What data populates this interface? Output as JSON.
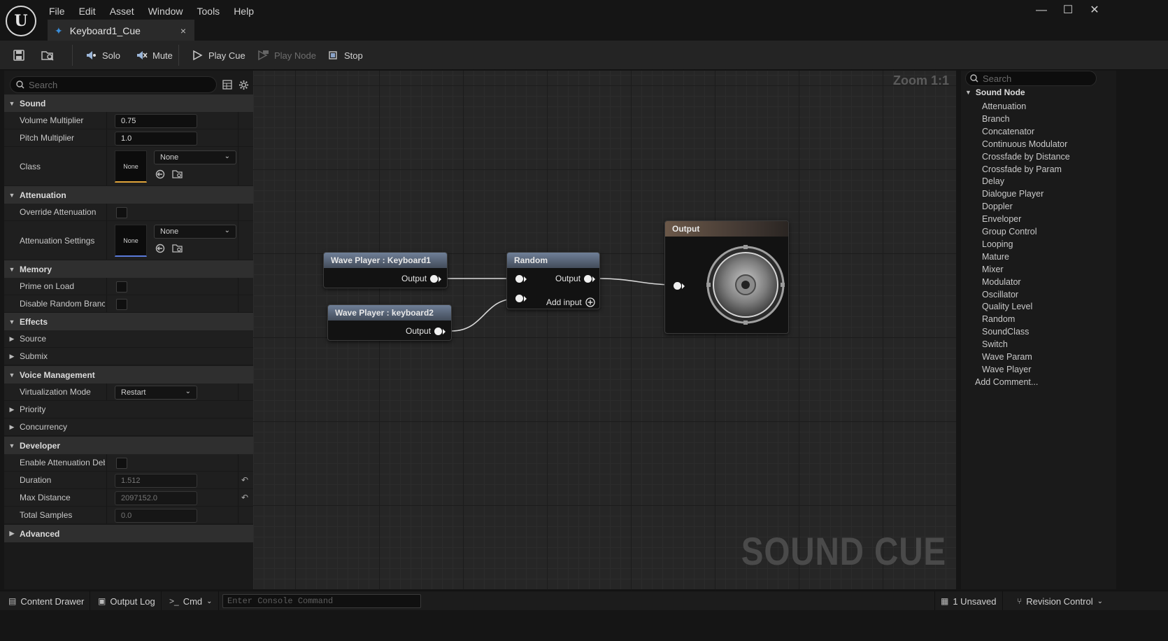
{
  "window": {
    "logo_text": "U",
    "menu": [
      "File",
      "Edit",
      "Asset",
      "Window",
      "Tools",
      "Help"
    ],
    "tab_label": "Keyboard1_Cue",
    "minimize": "—",
    "maximize": "☐",
    "close": "✕"
  },
  "toolbar": {
    "solo": "Solo",
    "mute": "Mute",
    "play_cue": "Play Cue",
    "play_node": "Play Node",
    "stop": "Stop"
  },
  "details": {
    "search_placeholder": "Search",
    "categories": {
      "sound": "Sound",
      "attenuation": "Attenuation",
      "memory": "Memory",
      "effects": "Effects",
      "voice_management": "Voice Management",
      "developer": "Developer",
      "advanced": "Advanced"
    },
    "volume_multiplier": {
      "label": "Volume Multiplier",
      "value": "0.75"
    },
    "pitch_multiplier": {
      "label": "Pitch Multiplier",
      "value": "1.0"
    },
    "class": {
      "label": "Class",
      "thumb": "None",
      "combo": "None"
    },
    "override_attenuation": {
      "label": "Override Attenuation",
      "checked": false
    },
    "attenuation_settings": {
      "label": "Attenuation Settings",
      "thumb": "None",
      "combo": "None"
    },
    "prime_on_load": {
      "label": "Prime on Load",
      "checked": false
    },
    "disable_random_branch": {
      "label": "Disable Random Branc...",
      "checked": false
    },
    "source": "Source",
    "submix": "Submix",
    "virtualization_mode": {
      "label": "Virtualization Mode",
      "value": "Restart"
    },
    "priority": "Priority",
    "concurrency": "Concurrency",
    "enable_attenuation_debug": {
      "label": "Enable Attenuation Deb...",
      "checked": false
    },
    "duration": {
      "label": "Duration",
      "value": "1.512"
    },
    "max_distance": {
      "label": "Max Distance",
      "value": "2097152.0"
    },
    "total_samples": {
      "label": "Total Samples",
      "value": "0.0"
    }
  },
  "graph": {
    "zoom": "Zoom 1:1",
    "watermark": "SOUND CUE",
    "nodes": {
      "wave1": {
        "title": "Wave Player : Keyboard1",
        "pin": "Output"
      },
      "wave2": {
        "title": "Wave Player : keyboard2",
        "pin": "Output"
      },
      "random": {
        "title": "Random",
        "output": "Output",
        "add_input": "Add input"
      },
      "output": {
        "title": "Output"
      }
    }
  },
  "palette": {
    "search_placeholder": "Search",
    "header": "Sound Node",
    "items": [
      "Attenuation",
      "Branch",
      "Concatenator",
      "Continuous Modulator",
      "Crossfade by Distance",
      "Crossfade by Param",
      "Delay",
      "Dialogue Player",
      "Doppler",
      "Enveloper",
      "Group Control",
      "Looping",
      "Mature",
      "Mixer",
      "Modulator",
      "Oscillator",
      "Quality Level",
      "Random",
      "SoundClass",
      "Switch",
      "Wave Param",
      "Wave Player"
    ],
    "add_comment": "Add Comment..."
  },
  "statusbar": {
    "content_drawer": "Content Drawer",
    "output_log": "Output Log",
    "cmd": "Cmd",
    "console_placeholder": "Enter Console Command",
    "unsaved": "1 Unsaved",
    "revision_control": "Revision Control"
  },
  "colors": {
    "accent_blue": "#3a8edb",
    "class_underline": "#e0a43a",
    "attenuation_underline": "#5a7ad9",
    "node_header": "#5d6a80"
  }
}
